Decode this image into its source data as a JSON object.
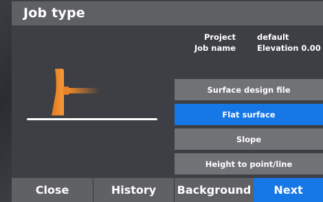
{
  "header": {
    "title": "Job type"
  },
  "info": {
    "project_label": "Project",
    "project_value": "default",
    "jobname_label": "Job name",
    "jobname_value": "Elevation 0.00"
  },
  "options": [
    {
      "label": "Surface design file",
      "selected": false
    },
    {
      "label": "Flat surface",
      "selected": true
    },
    {
      "label": "Slope",
      "selected": false
    },
    {
      "label": "Height to point/line",
      "selected": false
    }
  ],
  "footer": {
    "close_label": "Close",
    "history_label": "History",
    "background_label": "Background",
    "next_label": "Next"
  },
  "illustration": {
    "icon": "dozer-blade-icon",
    "blade_color": "#f08a2a",
    "ground_color": "#ffffff"
  },
  "colors": {
    "accent": "#1677e6",
    "option_bg": "#717276",
    "titlebar": "#5f6063",
    "panel": "#3e3f44"
  }
}
